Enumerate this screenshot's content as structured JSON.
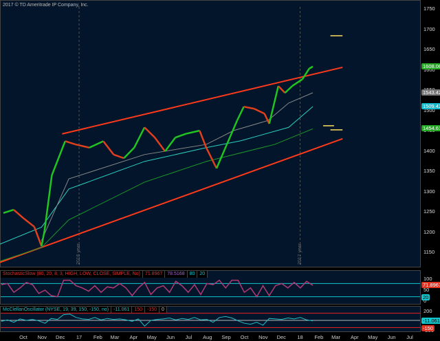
{
  "copyright": "2017 © TD Ameritrade IP Company, Inc.",
  "chart_data": [
    {
      "type": "line",
      "panel": "price",
      "ylim": [
        1100,
        1775
      ],
      "y_ticks": [
        "1750",
        "1700",
        "1650",
        "1600",
        "1550",
        "1500",
        "1450",
        "1400",
        "1350",
        "1300",
        "1250",
        "1200",
        "1150"
      ],
      "y_tick_values": [
        1750,
        1700,
        1650,
        1600,
        1550,
        1500,
        1450,
        1400,
        1350,
        1300,
        1250,
        1200,
        1150
      ],
      "price": [
        [
          "2016-08-29",
          1247
        ],
        [
          "2016-09-15",
          1255
        ],
        [
          "2016-10-02",
          1233
        ],
        [
          "2016-10-19",
          1213
        ],
        [
          "2016-10-31",
          1165
        ],
        [
          "2016-11-05",
          1204
        ],
        [
          "2016-11-17",
          1340
        ],
        [
          "2016-11-28",
          1382
        ],
        [
          "2016-12-09",
          1424
        ],
        [
          "2016-12-26",
          1416
        ],
        [
          "2017-01-18",
          1408
        ],
        [
          "2017-02-10",
          1424
        ],
        [
          "2017-02-27",
          1391
        ],
        [
          "2017-03-16",
          1382
        ],
        [
          "2017-04-02",
          1408
        ],
        [
          "2017-04-19",
          1458
        ],
        [
          "2017-05-06",
          1433
        ],
        [
          "2017-05-23",
          1399
        ],
        [
          "2017-06-09",
          1433
        ],
        [
          "2017-06-26",
          1442
        ],
        [
          "2017-07-19",
          1450
        ],
        [
          "2017-07-30",
          1408
        ],
        [
          "2017-08-16",
          1357
        ],
        [
          "2017-09-02",
          1416
        ],
        [
          "2017-09-19",
          1475
        ],
        [
          "2017-09-30",
          1509
        ],
        [
          "2017-10-17",
          1504
        ],
        [
          "2017-11-03",
          1492
        ],
        [
          "2017-11-11",
          1467
        ],
        [
          "2017-11-26",
          1560
        ],
        [
          "2017-12-07",
          1543
        ],
        [
          "2017-12-19",
          1560
        ],
        [
          "2018-01-05",
          1577
        ],
        [
          "2018-01-16",
          1603
        ],
        [
          "2018-01-22",
          1608.06
        ]
      ],
      "ma_gray": [
        [
          "2016-10-31",
          1179
        ],
        [
          "2016-12-15",
          1331
        ],
        [
          "2017-04-19",
          1391
        ],
        [
          "2017-07-30",
          1416
        ],
        [
          "2017-09-13",
          1450
        ],
        [
          "2017-11-09",
          1475
        ],
        [
          "2017-12-13",
          1518
        ],
        [
          "2018-01-22",
          1543.42
        ]
      ],
      "ma_cyan": [
        [
          "2016-08-23",
          1170
        ],
        [
          "2016-10-31",
          1212
        ],
        [
          "2016-12-15",
          1306
        ],
        [
          "2017-04-19",
          1374
        ],
        [
          "2017-07-30",
          1408
        ],
        [
          "2017-09-25",
          1425
        ],
        [
          "2017-12-13",
          1458
        ],
        [
          "2018-01-22",
          1509.42
        ]
      ],
      "ma_green": [
        [
          "2016-08-23",
          1128
        ],
        [
          "2016-10-31",
          1162
        ],
        [
          "2016-12-15",
          1230
        ],
        [
          "2017-04-19",
          1323
        ],
        [
          "2017-07-30",
          1374
        ],
        [
          "2017-11-20",
          1416
        ],
        [
          "2018-01-22",
          1454.61
        ]
      ],
      "channel_upper": [
        [
          "2016-12-04",
          1442
        ],
        [
          "2018-03-12",
          1606
        ]
      ],
      "channel_lower": [
        [
          "2016-08-23",
          1125
        ],
        [
          "2018-03-12",
          1430
        ]
      ],
      "markers": [
        [
          "2018-02-20",
          "2018-03-12",
          1684
        ],
        [
          "2018-02-08",
          "2018-02-26",
          1462
        ],
        [
          "2018-02-20",
          "2018-03-12",
          1452
        ]
      ],
      "last_labels": [
        {
          "value": "1608.06",
          "color": "#22a822"
        },
        {
          "value": "1543.42",
          "color": "#777777"
        },
        {
          "value": "1509.42",
          "color": "#11bbcc"
        },
        {
          "value": "1454.61",
          "color": "#22a822"
        }
      ],
      "year_lines": [
        {
          "date": "2017-01-01",
          "label": "2016 year"
        },
        {
          "date": "2018-01-01",
          "label": "2017 year"
        }
      ]
    },
    {
      "type": "line",
      "panel": "stochastic",
      "title": "StochasticSlow (80, 20, 8, 3, HIGH, LOW, CLOSE, SIMPLE, No)",
      "values_text": [
        "71.8967",
        "78.5168",
        "80",
        "20"
      ],
      "ylim": [
        0,
        100
      ],
      "levels": [
        80,
        20
      ],
      "y_ticks": [
        "100",
        "50",
        "0"
      ],
      "right_labels": [
        "71.8967",
        "20"
      ],
      "values": [
        75,
        80,
        40,
        60,
        85,
        75,
        35,
        50,
        25,
        20,
        95,
        95,
        70,
        60,
        45,
        70,
        40,
        65,
        60,
        80,
        60,
        25,
        60,
        85,
        30,
        60,
        70,
        40,
        90,
        70,
        40,
        75,
        30,
        80,
        75,
        95,
        60,
        95,
        95,
        40,
        60,
        20,
        70,
        25,
        70,
        80,
        60,
        85,
        60,
        90,
        72
      ]
    },
    {
      "type": "line",
      "panel": "mcclellan",
      "title": "McClellanOscillator (NYSE, 19, 39, 150, -150, no)",
      "values_text": [
        "-11.061",
        "150",
        "-150",
        "0"
      ],
      "ylim": [
        -200,
        200
      ],
      "levels": [
        150,
        0,
        -150
      ],
      "y_ticks": [
        "200",
        "-200"
      ],
      "right_labels": [
        "-11.061",
        "-150"
      ],
      "values": [
        -20,
        10,
        -40,
        30,
        0,
        20,
        -10,
        -60,
        40,
        20,
        120,
        130,
        60,
        30,
        20,
        60,
        10,
        40,
        20,
        30,
        10,
        -20,
        30,
        -120,
        0,
        20,
        30,
        50,
        10,
        40,
        20,
        60,
        10,
        20,
        -40,
        60,
        80,
        50,
        -10,
        -60,
        -80,
        -40,
        -100,
        40,
        30,
        20,
        50,
        30,
        60,
        10,
        -11
      ]
    }
  ],
  "x_ticks": [
    [
      "2016-10-01",
      "Oct"
    ],
    [
      "2016-11-01",
      "Nov"
    ],
    [
      "2016-12-01",
      "Dec"
    ],
    [
      "2017-01-01",
      "17"
    ],
    [
      "2017-02-01",
      "Feb"
    ],
    [
      "2017-03-01",
      "Mar"
    ],
    [
      "2017-04-01",
      "Apr"
    ],
    [
      "2017-05-01",
      "May"
    ],
    [
      "2017-06-01",
      "Jun"
    ],
    [
      "2017-07-01",
      "Jul"
    ],
    [
      "2017-08-01",
      "Aug"
    ],
    [
      "2017-09-01",
      "Sep"
    ],
    [
      "2017-10-01",
      "Oct"
    ],
    [
      "2017-11-01",
      "Nov"
    ],
    [
      "2017-12-01",
      "Dec"
    ],
    [
      "2018-01-01",
      "18"
    ],
    [
      "2018-02-01",
      "Feb"
    ],
    [
      "2018-03-01",
      "Mar"
    ],
    [
      "2018-04-01",
      "Apr"
    ],
    [
      "2018-05-01",
      "May"
    ],
    [
      "2018-06-01",
      "Jun"
    ],
    [
      "2018-07-01",
      "Jul"
    ]
  ],
  "colors": {
    "bg": "#02152b",
    "up": "#22c422",
    "down": "#e0401e",
    "channel": "#ff3a1a",
    "marker": "#ffe060",
    "stoch": "#c0304a",
    "stoch2": "#9050d0",
    "mcc": "#22c0c8",
    "level": "#11c8d0"
  }
}
